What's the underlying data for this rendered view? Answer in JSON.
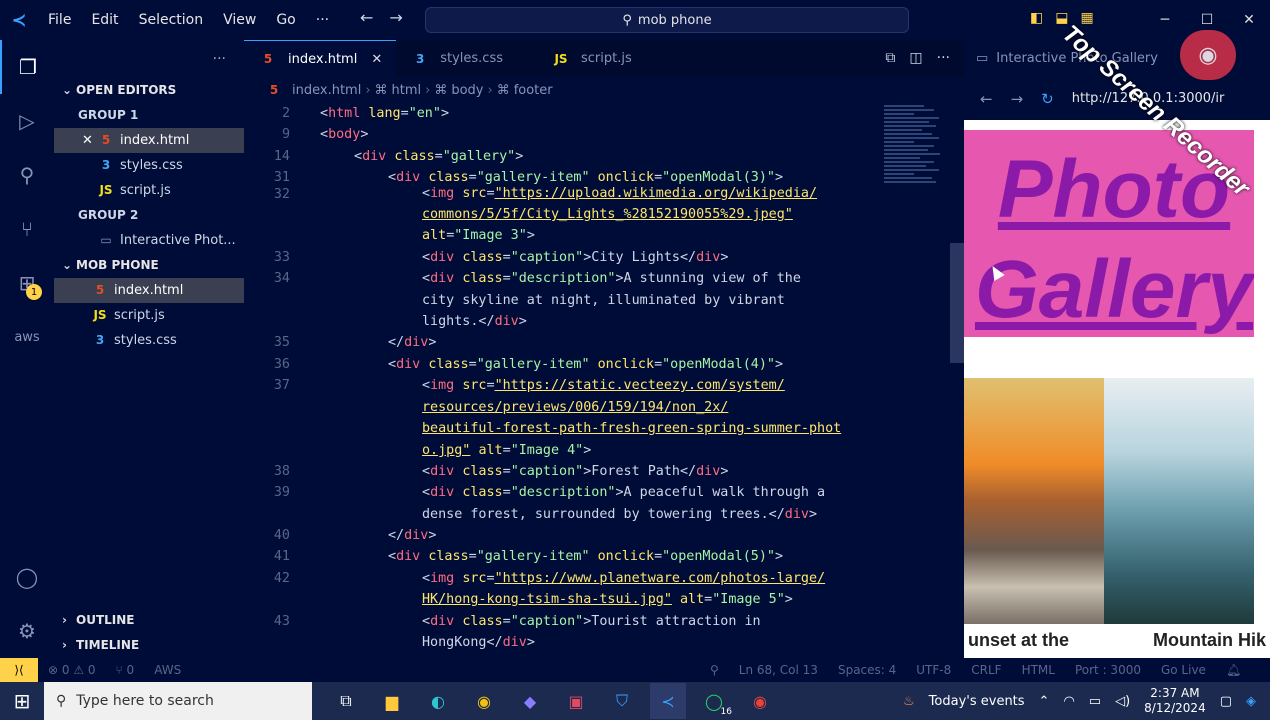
{
  "titlebar": {
    "menu": [
      "File",
      "Edit",
      "Selection",
      "View",
      "Go",
      "···"
    ],
    "search": "mob phone"
  },
  "activity": {
    "items": [
      "explorer-icon",
      "run-debug-icon",
      "search-icon",
      "source-control-icon",
      "extensions-icon",
      "aws-icon"
    ],
    "extensions_badge": "1",
    "aws_label": "aws"
  },
  "sidebar": {
    "open_editors": "OPEN EDITORS",
    "group1": "GROUP 1",
    "group1_files": [
      "index.html",
      "styles.css",
      "script.js"
    ],
    "group2": "GROUP 2",
    "group2_files": [
      "Interactive Phot..."
    ],
    "project": "MOB PHONE",
    "project_files": [
      "index.html",
      "script.js",
      "styles.css"
    ],
    "outline": "OUTLINE",
    "timeline": "TIMELINE"
  },
  "tabs": {
    "t1": "index.html",
    "t2": "styles.css",
    "t3": "script.js"
  },
  "breadcrumb": [
    "index.html",
    "html",
    "body",
    "footer"
  ],
  "code": {
    "line_numbers": [
      "2",
      "9",
      "14",
      "31",
      "32",
      "",
      "33",
      "34",
      "",
      "",
      "35",
      "36",
      "37",
      "",
      "",
      "",
      "38",
      "39",
      "",
      "40",
      "41",
      "42",
      "",
      "43",
      ""
    ]
  },
  "browser": {
    "tab_title": "Interactive Photo Gallery",
    "url": "http://127.0.0.1:3000/ir",
    "banner": "Photo Gallery",
    "caption1": "unset at the",
    "caption2": "Mountain Hik"
  },
  "watermark": "Top Screen Recorder",
  "statusbar": {
    "errors": "⊗ 0 ⚠ 0",
    "ports": "⑂ 0",
    "aws": "AWS",
    "position": "Ln 68, Col 13",
    "spaces": "Spaces: 4",
    "encoding": "UTF-8",
    "eol": "CRLF",
    "lang": "HTML",
    "port": "Port : 3000",
    "golive": "Go Live"
  },
  "taskbar": {
    "search_placeholder": "Type here to search",
    "events": "Today's events",
    "time": "2:37 AM",
    "date": "8/12/2024",
    "whatsapp_badge": "16"
  },
  "colors": {
    "bg": "#000c38",
    "accent": "#3aa0ff",
    "banner": "#e657b0",
    "banner_text": "#8c1aa8"
  }
}
